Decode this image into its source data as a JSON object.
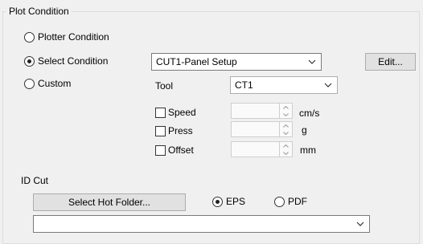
{
  "plot_condition": {
    "title": "Plot Condition",
    "radio_plotter": "Plotter Condition",
    "radio_select": "Select Condition",
    "radio_custom": "Custom",
    "selected_radio": "Select Condition",
    "condition_combo_value": "CUT1-Panel Setup",
    "edit_button": "Edit...",
    "tool_label": "Tool",
    "tool_combo_value": "CT1",
    "speed_label": "Speed",
    "speed_unit": "cm/s",
    "press_label": "Press",
    "press_unit": "g",
    "offset_label": "Offset",
    "offset_unit": "mm"
  },
  "id_cut": {
    "title": "ID Cut",
    "hot_folder_button": "Select Hot Folder...",
    "radio_eps": "EPS",
    "radio_pdf": "PDF",
    "selected_format": "EPS",
    "folder_combo_value": ""
  },
  "icons": {
    "dropdown": "chevron-down-icon",
    "spin_up": "caret-up-icon",
    "spin_down": "caret-down-icon"
  }
}
